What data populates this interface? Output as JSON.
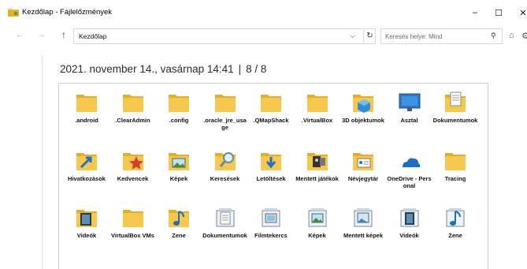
{
  "window": {
    "title": "Kezdőlap - Fájlelőzmények",
    "minimize_glyph": "–",
    "maximize_glyph": "☐",
    "close_glyph": "✕"
  },
  "nav": {
    "back_glyph": "←",
    "forward_glyph": "→",
    "up_glyph": "↑",
    "address": "Kezdőlap",
    "search_placeholder": "Keresés helye: Mind"
  },
  "header": {
    "date": "2021. november 14., vasárnap 14:41",
    "separator": "|",
    "version": "8 / 8"
  },
  "colors": {
    "folder": "#f6c94e",
    "folder_dark": "#e6ad27",
    "accent_blue": "#1e73c8"
  },
  "items": [
    {
      "label": ".android",
      "icon": "folder-icon"
    },
    {
      "label": ".ClearAdmin",
      "icon": "folder-icon"
    },
    {
      "label": ".config",
      "icon": "folder-icon"
    },
    {
      "label": ".oracle_jre_usage",
      "icon": "folder-icon"
    },
    {
      "label": ".QMapShack",
      "icon": "folder-icon"
    },
    {
      "label": ".VirtualBox",
      "icon": "folder-icon"
    },
    {
      "label": "3D objektumok",
      "icon": "3d-objects-icon"
    },
    {
      "label": "Asztal",
      "icon": "desktop-icon"
    },
    {
      "label": "Dokumentumok",
      "icon": "documents-folder-icon"
    },
    {
      "label": "Hivatkozások",
      "icon": "links-icon"
    },
    {
      "label": "Kedvencek",
      "icon": "favorites-icon"
    },
    {
      "label": "Képek",
      "icon": "pictures-folder-icon"
    },
    {
      "label": "Keresések",
      "icon": "searches-icon"
    },
    {
      "label": "Letöltések",
      "icon": "downloads-icon"
    },
    {
      "label": "Mentett játékok",
      "icon": "saved-games-icon"
    },
    {
      "label": "Névjegytár",
      "icon": "contacts-icon"
    },
    {
      "label": "OneDrive - Personal",
      "icon": "onedrive-icon"
    },
    {
      "label": "Tracing",
      "icon": "folder-icon"
    },
    {
      "label": "Videók",
      "icon": "videos-folder-icon"
    },
    {
      "label": "VirtualBox VMs",
      "icon": "folder-icon"
    },
    {
      "label": "Zene",
      "icon": "music-folder-icon"
    },
    {
      "label": "Dokumentumok",
      "icon": "documents-library-icon"
    },
    {
      "label": "Filmtekercs",
      "icon": "camera-roll-library-icon"
    },
    {
      "label": "Képek",
      "icon": "pictures-library-icon"
    },
    {
      "label": "Mentett képek",
      "icon": "saved-pictures-library-icon"
    },
    {
      "label": "Videók",
      "icon": "videos-library-icon"
    },
    {
      "label": "Zene",
      "icon": "music-library-icon"
    }
  ]
}
